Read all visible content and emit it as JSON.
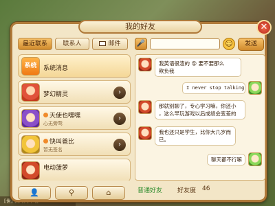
{
  "dialog": {
    "title": "我的好友",
    "close": "✕"
  },
  "tabs": {
    "recent": "最近联系",
    "contacts": "联系人",
    "mail": "邮件"
  },
  "contacts": [
    {
      "name": "系统消息",
      "signature": "",
      "avatar_text": "系统"
    },
    {
      "name": "梦幻精灵",
      "signature": ""
    },
    {
      "name": "天使也嘿嘿",
      "signature": "心无旁骛"
    },
    {
      "name": "快叫爸比",
      "signature": "暂无签名"
    },
    {
      "name": "电动菠萝",
      "signature": ""
    }
  ],
  "bottom_buttons": {
    "friend": "👤",
    "location": "⚲",
    "home": "⌂"
  },
  "chat": {
    "input_placeholder": "",
    "send": "发送",
    "mic": "🎤",
    "emoji": "☺",
    "messages": [
      {
        "from": "other",
        "text_1": "我英语很渣的",
        "text_2": "要不要那么",
        "text_3": "欺负我"
      },
      {
        "from": "me",
        "text": "I never stop talking"
      },
      {
        "from": "other",
        "text_1": "那就别聊了，专心学习嘛，你还小",
        "text_2": "，这么早玩游戏以后成绩会变差的"
      },
      {
        "from": "other",
        "text_1": "我也还只是学生，比你大几岁而",
        "text_2": "已。"
      },
      {
        "from": "me",
        "text": "聊天都不行嘛"
      }
    ]
  },
  "friend_bar": {
    "type": "普通好友",
    "level_label": "好友度",
    "level_value": "46"
  },
  "background": {
    "top_text": "",
    "bottom_text": "[世] 我的火车哦"
  }
}
